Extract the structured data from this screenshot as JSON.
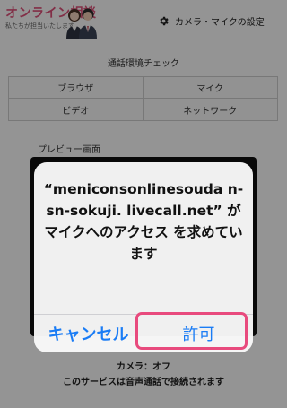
{
  "header": {
    "brand_title": "オンライン相談",
    "brand_subtitle": "私たちが担当いたします",
    "settings_label": "カメラ・マイクの設定",
    "settings_icon": "gear-icon"
  },
  "environment_check": {
    "title": "通話環境チェック",
    "items": [
      "ブラウザ",
      "マイク",
      "ビデオ",
      "ネットワーク"
    ]
  },
  "preview": {
    "title": "プレビュー画面"
  },
  "status": {
    "camera": "カメラ：オフ",
    "service_note": "このサービスは音声通話で接続されます"
  },
  "alert": {
    "message": "“meniconsonlinesouda n-sn-sokuji. livecall.net” が マイクへのアクセス を求めています",
    "cancel_label": "キャンセル",
    "allow_label": "許可"
  },
  "colors": {
    "brand": "#e0527a",
    "ios_blue": "#1a7cf5",
    "highlight": "#e84a7d"
  }
}
